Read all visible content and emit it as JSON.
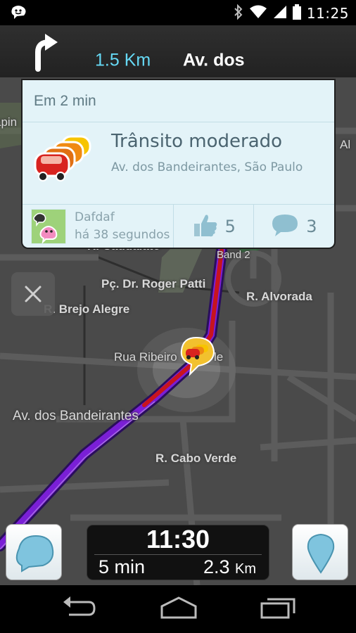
{
  "status_bar": {
    "time": "11:25"
  },
  "navigation": {
    "distance": "1.5 Km",
    "street": "Av. dos"
  },
  "alert": {
    "eta_text": "Em 2 min",
    "title": "Trânsito moderado",
    "location": "Av. dos Bandeirantes, São Paulo",
    "reporter": "Dafdaf",
    "reported_ago": "há 38 segundos",
    "likes": "5",
    "comments": "3"
  },
  "map_labels": {
    "partial_left": "apin",
    "partial_right": "Al",
    "partial_top": "R. Caudalato",
    "pca": "Pç. Dr. Roger Patti",
    "brejo": "R. Brejo Alegre",
    "alvorada": "R. Alvorada",
    "ribeiro_a": "Rua Ribeiro",
    "ribeiro_b": "le",
    "bandeirantes": "Av. dos Bandeirantes",
    "cabo": "R. Cabo Verde",
    "band2": "Band 2"
  },
  "trip": {
    "arrival": "11:30",
    "remaining_time": "5 min",
    "remaining_distance": "2.3",
    "distance_unit": "Km"
  },
  "colors": {
    "accent": "#66d9f5",
    "route": "#7a1fd6",
    "traffic": "#c8141e",
    "card_bg": "#e3f3f8"
  }
}
